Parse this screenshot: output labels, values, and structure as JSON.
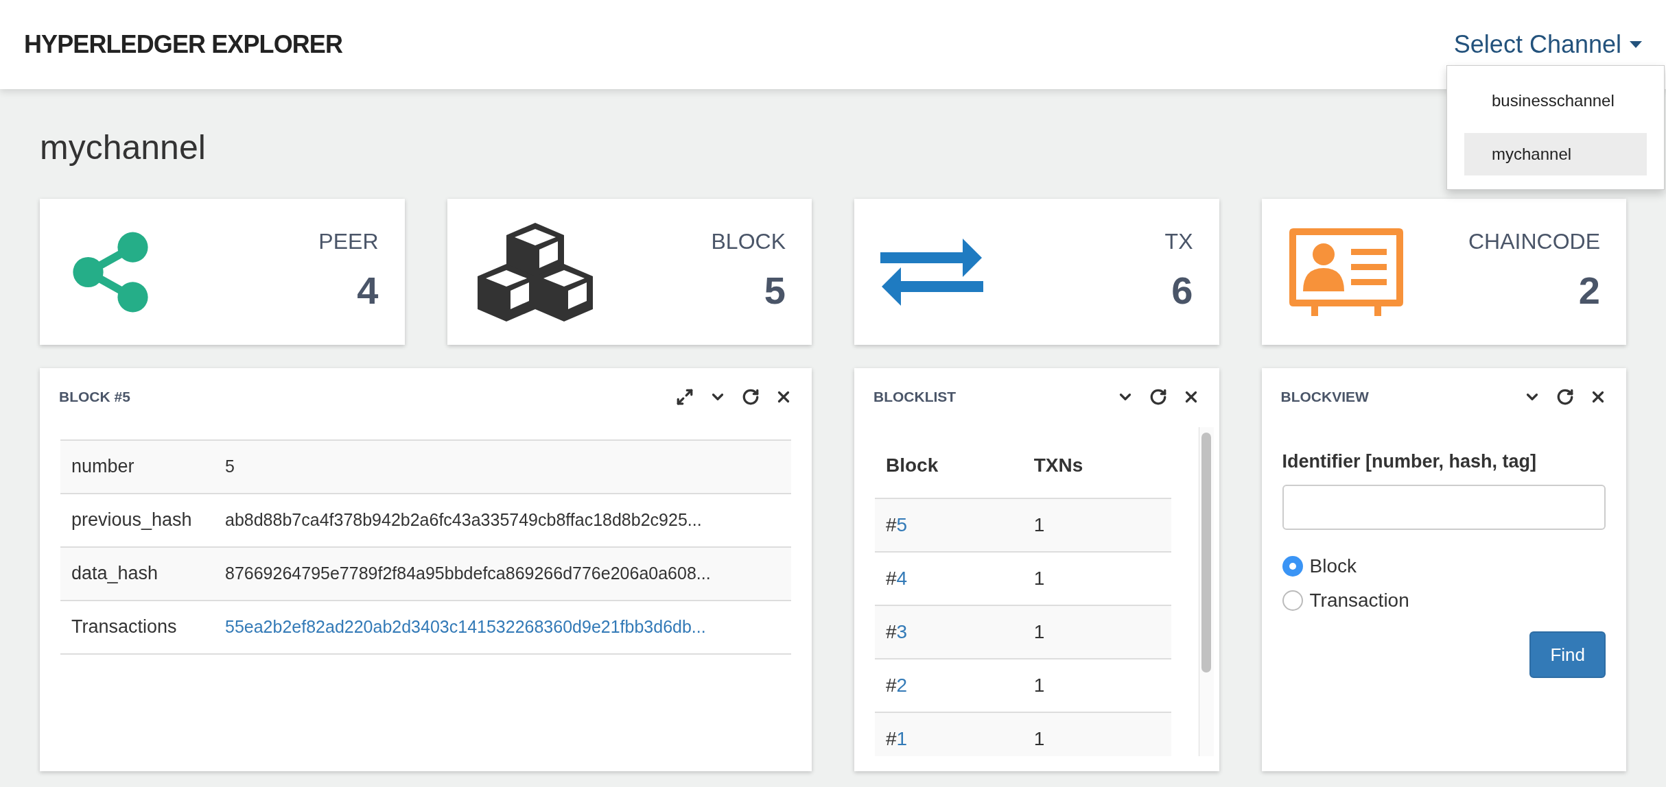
{
  "header": {
    "title": "HYPERLEDGER EXPLORER",
    "channel_menu": {
      "label": "Select Channel",
      "expanded": true,
      "items": [
        {
          "label": "businesschannel",
          "selected": false
        },
        {
          "label": "mychannel",
          "selected": true
        }
      ]
    }
  },
  "page_title": "mychannel",
  "stats": [
    {
      "kind": "share",
      "color": "#25ae88",
      "label": "PEER",
      "value": "4"
    },
    {
      "kind": "cubes",
      "color": "#333333",
      "label": "BLOCK",
      "value": "5"
    },
    {
      "kind": "arrows",
      "color": "#1f7bc1",
      "label": "TX",
      "value": "6"
    },
    {
      "kind": "card",
      "color": "#f7923a",
      "label": "CHAINCODE",
      "value": "2"
    }
  ],
  "block_panel": {
    "title": "BLOCK #5",
    "controls": [
      {
        "kind": "expand"
      },
      {
        "kind": "collapse"
      },
      {
        "kind": "refresh"
      },
      {
        "kind": "close"
      }
    ],
    "rows": [
      {
        "key": "number",
        "value": "5",
        "kind": "text"
      },
      {
        "key": "previous_hash",
        "value": "ab8d88b7ca4f378b942b2a6fc43a335749cb8ffac18d8b2c925...",
        "kind": "text"
      },
      {
        "key": "data_hash",
        "value": "87669264795e7789f2f84a95bbdefca869266d776e206a0a608...",
        "kind": "text"
      },
      {
        "key": "Transactions",
        "value": "55ea2b2ef82ad220ab2d3403c141532268360d9e21fbb3d6db...",
        "kind": "link"
      }
    ]
  },
  "blocklist_panel": {
    "title": "BLOCKLIST",
    "controls": [
      {
        "kind": "collapse"
      },
      {
        "kind": "refresh"
      },
      {
        "kind": "close"
      }
    ],
    "columns": [
      "Block",
      "TXNs"
    ],
    "rows": [
      {
        "hash_mark": "#",
        "block": "5",
        "txns": "1"
      },
      {
        "hash_mark": "#",
        "block": "4",
        "txns": "1"
      },
      {
        "hash_mark": "#",
        "block": "3",
        "txns": "1"
      },
      {
        "hash_mark": "#",
        "block": "2",
        "txns": "1"
      },
      {
        "hash_mark": "#",
        "block": "1",
        "txns": "1"
      }
    ]
  },
  "blockview_panel": {
    "title": "BLOCKVIEW",
    "controls": [
      {
        "kind": "collapse"
      },
      {
        "kind": "refresh"
      },
      {
        "kind": "close"
      }
    ],
    "field_label": "Identifier [number, hash, tag]",
    "options": [
      {
        "label": "Block",
        "selected": true
      },
      {
        "label": "Transaction",
        "selected": false
      }
    ],
    "button": "Find"
  }
}
